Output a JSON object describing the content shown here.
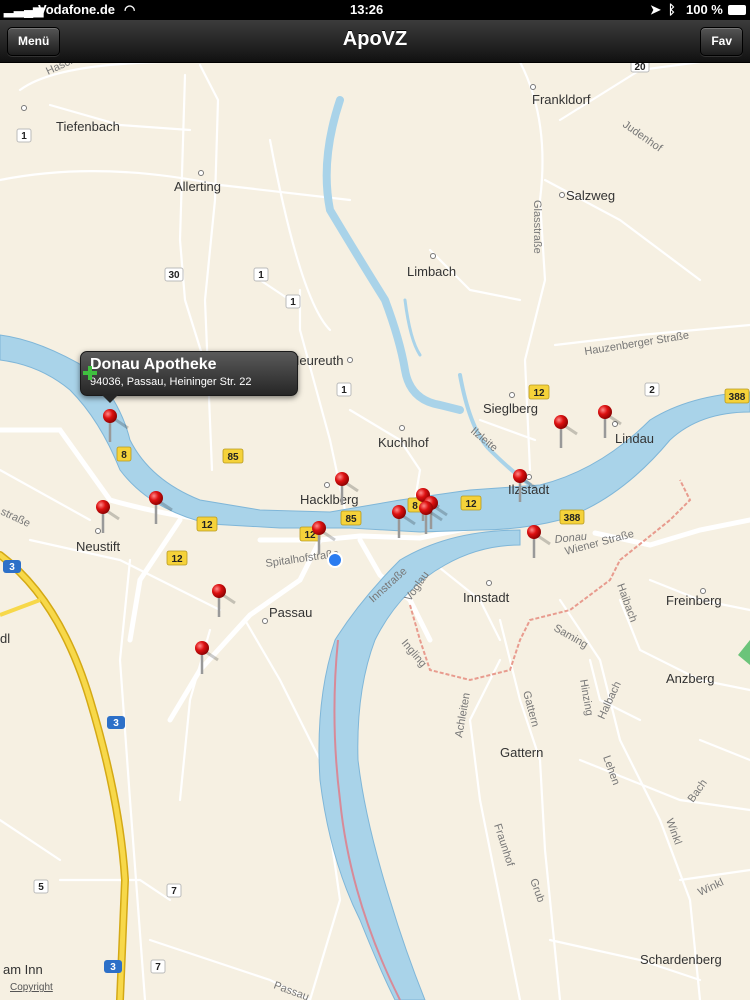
{
  "status_bar": {
    "carrier": "Vodafone.de",
    "time": "13:26",
    "battery": "100 %"
  },
  "nav": {
    "title": "ApoVZ",
    "left_button": "Menü",
    "right_button": "Fav"
  },
  "callout": {
    "title": "Donau Apotheke",
    "subtitle": "94036, Passau, Heininger Str. 22"
  },
  "places": [
    "Frankldorf",
    "Tiefenbach",
    "Allerting",
    "Salzweg",
    "Limbach",
    "Neureuth",
    "Kuchlhof",
    "Sieglberg",
    "Hacklberg",
    "Ilzstadt",
    "Lindau",
    "Neustift",
    "Passau",
    "Innstadt",
    "Freinberg",
    "Schardenberg",
    "Anzberg",
    "Gattern",
    "am Inn",
    "dl"
  ],
  "streets": [
    "Judenhof",
    "Glasstraße",
    "Hauzenberger Straße",
    "Ilzleite",
    "Spitalhofstraße",
    "Innstraße",
    "Voglau",
    "Wiener Straße",
    "Donau",
    "Haibach",
    "Saming",
    "Ingling",
    "Achleiten",
    "Gattern",
    "Hinzing",
    "Halbach",
    "Lehen",
    "Bach",
    "Winkl",
    "Winkl",
    "Fraunhof",
    "Grub",
    "Passau",
    "straße",
    "Hasch"
  ],
  "route_shields": [
    "20",
    "1",
    "30",
    "1",
    "1",
    "1",
    "85",
    "8",
    "12",
    "12",
    "85",
    "12",
    "8",
    "12",
    "388",
    "12",
    "2",
    "388",
    "3",
    "3",
    "3",
    "5",
    "7",
    "7"
  ],
  "copyright": "Copyright",
  "pin_count": 15
}
